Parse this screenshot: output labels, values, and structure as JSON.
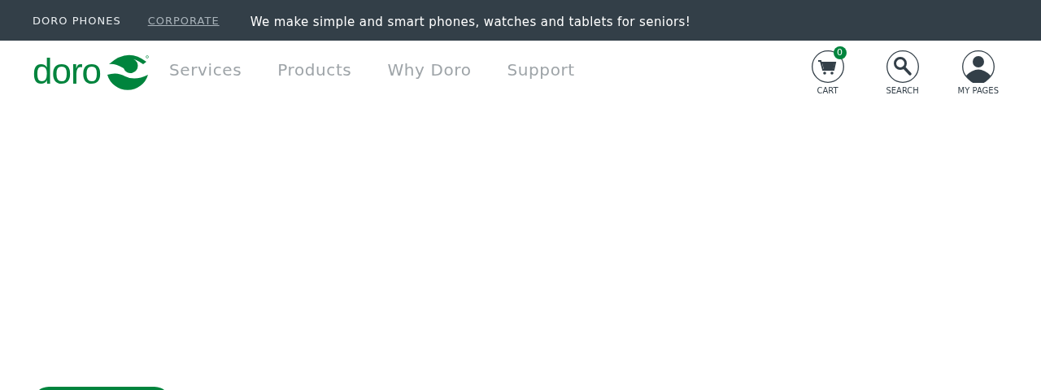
{
  "top_bar": {
    "links": [
      {
        "label": "DORO PHONES",
        "selected": true
      },
      {
        "label": "CORPORATE",
        "selected": false
      }
    ],
    "tagline": "We make simple and smart phones, watches and tablets for seniors!"
  },
  "header": {
    "logo": "doro",
    "nav": [
      "Services",
      "Products",
      "Why Doro",
      "Support"
    ],
    "actions": [
      {
        "kind": "cart",
        "label": "CART",
        "badge": "0"
      },
      {
        "kind": "search",
        "label": "SEARCH"
      },
      {
        "kind": "account",
        "label": "MY PAGES"
      }
    ]
  }
}
